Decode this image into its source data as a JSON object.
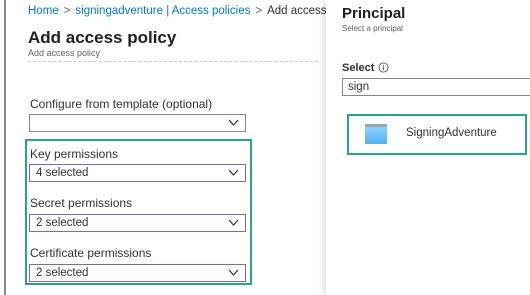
{
  "breadcrumb": {
    "items": [
      "Home",
      "signingadventure | Access policies"
    ],
    "separator": ">",
    "current": "Add access po"
  },
  "page": {
    "title": "Add access policy",
    "subtitle": "Add access policy"
  },
  "template": {
    "label": "Configure from template (optional)",
    "value": ""
  },
  "permissions": {
    "key": {
      "label": "Key permissions",
      "value": "4 selected"
    },
    "secret": {
      "label": "Secret permissions",
      "value": "2 selected"
    },
    "certificate": {
      "label": "Certificate permissions",
      "value": "2 selected"
    }
  },
  "principal": {
    "title": "Principal",
    "subtitle": "Select a principal",
    "select_label": "Select",
    "search_value": "sign",
    "results": [
      {
        "name": "SigningAdventure",
        "icon": "app-registration-icon"
      }
    ]
  },
  "colors": {
    "link": "#0078d4",
    "highlight": "#27a58a",
    "focus_border": "#8764b8"
  }
}
